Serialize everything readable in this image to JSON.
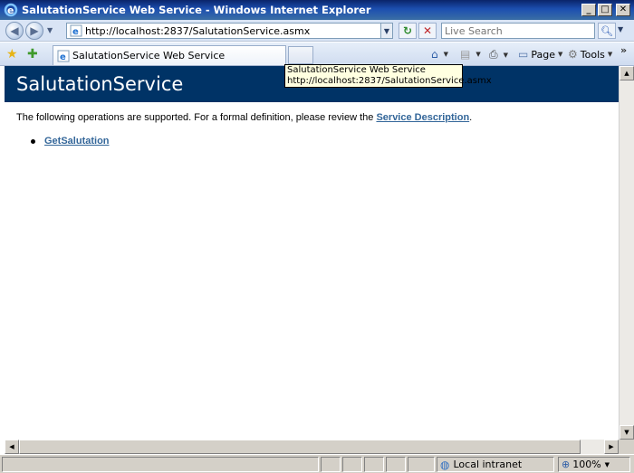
{
  "window": {
    "title": "SalutationService Web Service - Windows Internet Explorer",
    "minimize": "_",
    "maximize": "□",
    "close": "✕"
  },
  "nav": {
    "url": "http://localhost:2837/SalutationService.asmx",
    "search_placeholder": "Live Search"
  },
  "tab": {
    "label": "SalutationService Web Service"
  },
  "commands": {
    "page": "Page",
    "tools": "Tools"
  },
  "tooltip": {
    "line1": "SalutationService Web Service",
    "line2": "http://localhost:2837/SalutationService.asmx"
  },
  "content": {
    "heading": "SalutationService",
    "intro_prefix": "The following operations are supported. For a formal definition, please review the ",
    "intro_link": "Service Description",
    "intro_suffix": ".",
    "operations": [
      "GetSalutation"
    ]
  },
  "status": {
    "zone": "Local intranet",
    "zoom": "100%"
  },
  "colors": {
    "heading_band": "#003366",
    "link": "#336699"
  }
}
